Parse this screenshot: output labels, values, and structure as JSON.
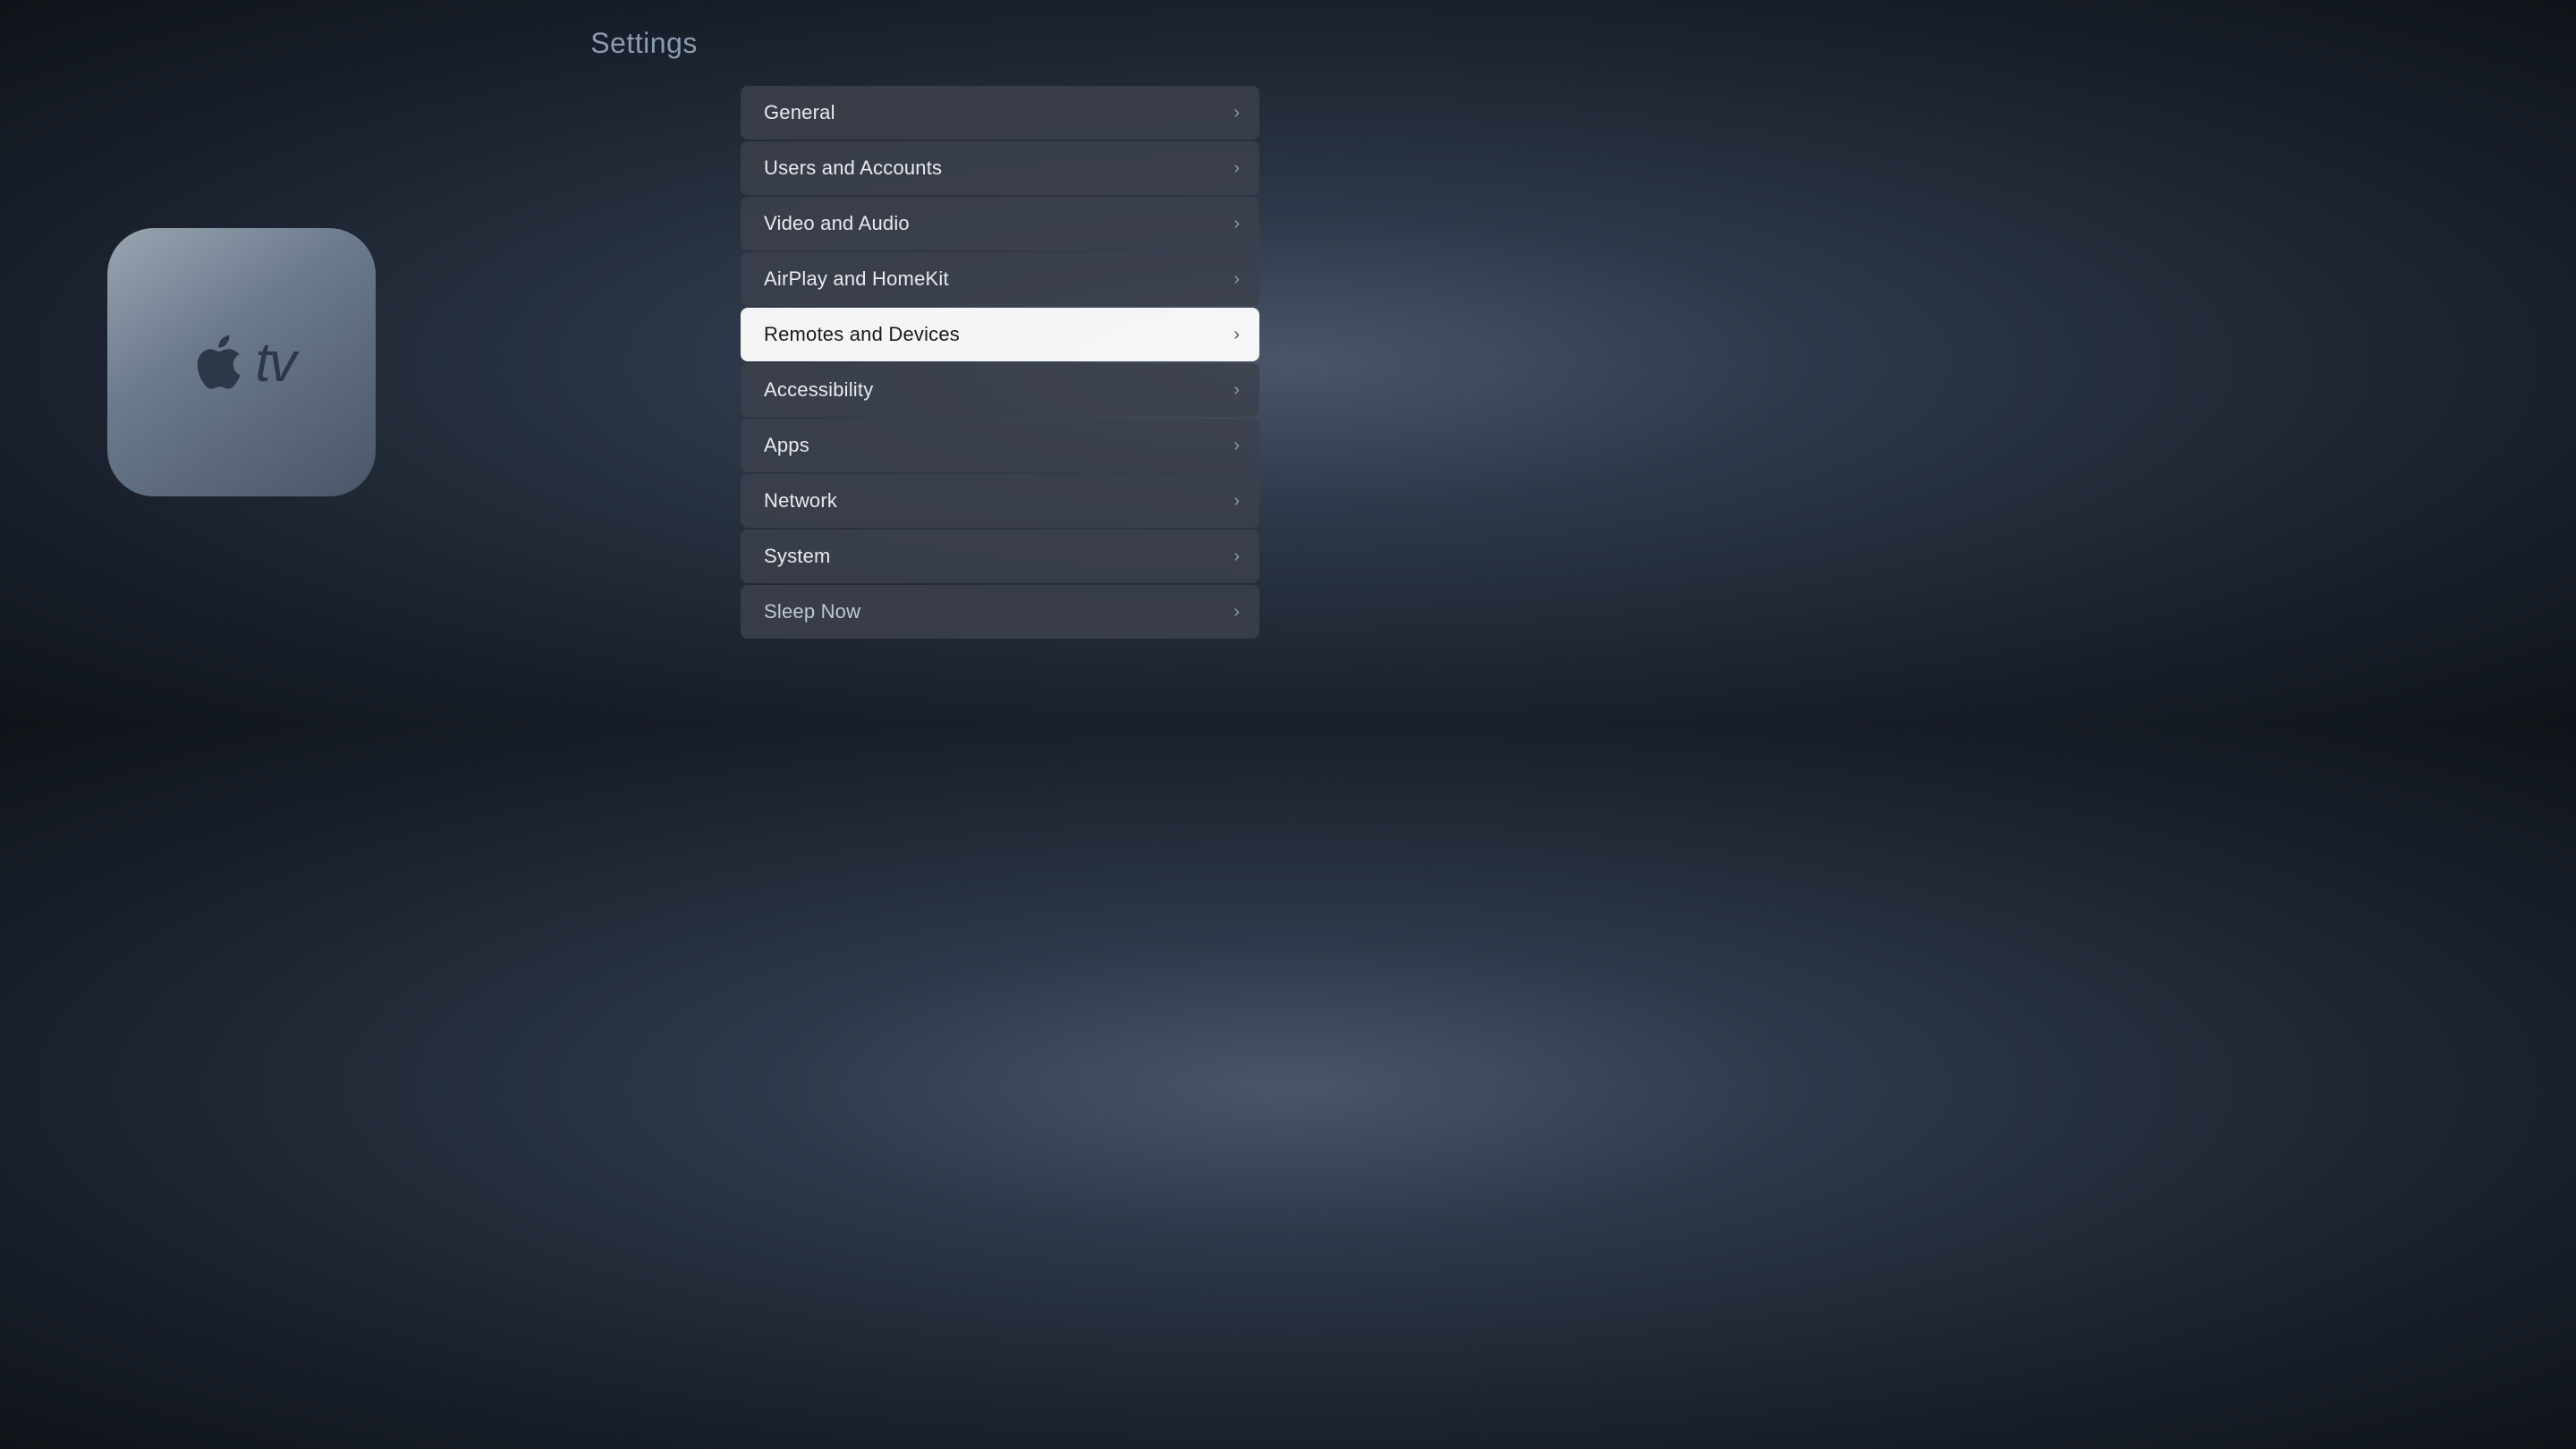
{
  "page": {
    "title": "Settings"
  },
  "apple_tv_icon": {
    "tv_label": "tv"
  },
  "menu": {
    "items": [
      {
        "id": "general",
        "label": "General",
        "selected": false
      },
      {
        "id": "users-and-accounts",
        "label": "Users and Accounts",
        "selected": false
      },
      {
        "id": "video-and-audio",
        "label": "Video and Audio",
        "selected": false
      },
      {
        "id": "airplay-and-homekit",
        "label": "AirPlay and HomeKit",
        "selected": false
      },
      {
        "id": "remotes-and-devices",
        "label": "Remotes and Devices",
        "selected": true
      },
      {
        "id": "accessibility",
        "label": "Accessibility",
        "selected": false
      },
      {
        "id": "apps",
        "label": "Apps",
        "selected": false
      },
      {
        "id": "network",
        "label": "Network",
        "selected": false
      },
      {
        "id": "system",
        "label": "System",
        "selected": false
      },
      {
        "id": "sleep-now",
        "label": "Sleep Now",
        "selected": false,
        "special": true
      }
    ],
    "chevron": "›"
  }
}
